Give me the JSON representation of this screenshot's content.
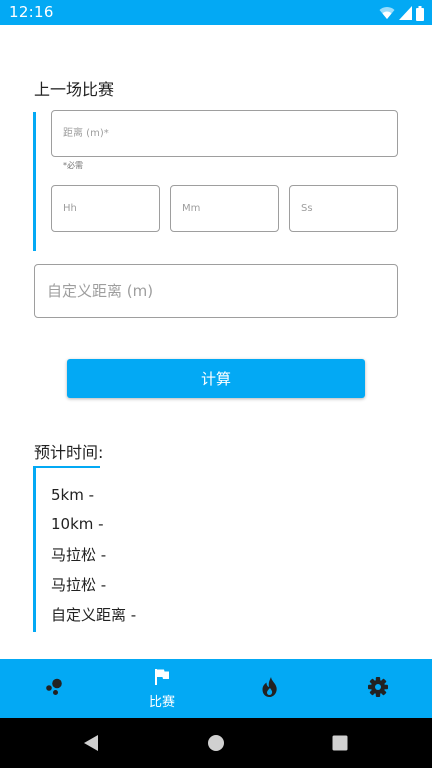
{
  "status_bar": {
    "time": "12:16"
  },
  "last_race": {
    "title": "上一场比赛",
    "distance_placeholder": "距离 (m)*",
    "required_hint": "*必需",
    "hours_placeholder": "Hh",
    "minutes_placeholder": "Mm",
    "seconds_placeholder": "Ss",
    "custom_distance_placeholder": "自定义距离 (m)"
  },
  "calculate_button": "计算",
  "estimated": {
    "title": "预计时间:",
    "results": [
      "5km -",
      "10km -",
      "马拉松 -",
      "马拉松 -",
      "自定义距离 -"
    ]
  },
  "bottom_nav": {
    "items": [
      {
        "icon": "dots-icon",
        "label": ""
      },
      {
        "icon": "flag-icon",
        "label": "比赛"
      },
      {
        "icon": "flame-icon",
        "label": ""
      },
      {
        "icon": "gear-icon",
        "label": ""
      }
    ]
  },
  "colors": {
    "accent": "#03A9F4",
    "nav_bar": "#000000"
  }
}
